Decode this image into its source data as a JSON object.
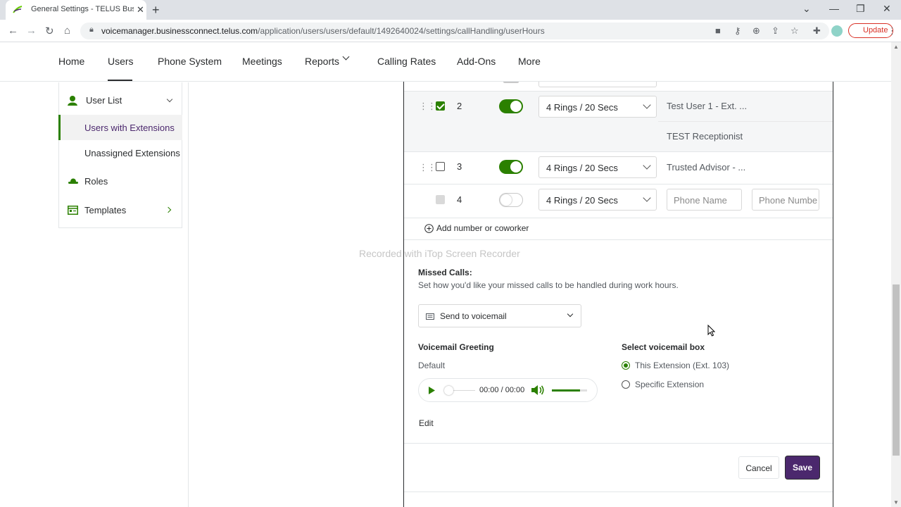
{
  "browser": {
    "tab_title": "General Settings - TELUS Business",
    "url_host": "voicemanager.businessconnect.telus.com",
    "url_path": "/application/users/users/default/1492640024/settings/callHandling/userHours",
    "update_label": "Update"
  },
  "nav": {
    "items": [
      "Home",
      "Users",
      "Phone System",
      "Meetings",
      "Reports",
      "Calling Rates",
      "Add-Ons",
      "More"
    ],
    "active": "Users"
  },
  "sidebar": {
    "user_list": "User List",
    "users_with_extensions": "Users with Extensions",
    "unassigned_extensions": "Unassigned Extensions",
    "roles": "Roles",
    "templates": "Templates"
  },
  "rows": [
    {
      "num": "2",
      "checked": true,
      "enabled": true,
      "rings": "4 Rings / 20 Secs",
      "target": "Test User 1 - Ext. ...",
      "sub": "TEST Receptionist"
    },
    {
      "num": "3",
      "checked": false,
      "enabled": true,
      "rings": "4 Rings / 20 Secs",
      "target": "Trusted Advisor - ..."
    },
    {
      "num": "4",
      "checked": false,
      "enabled": false,
      "rings": "4 Rings / 20 Secs",
      "phone_name_placeholder": "Phone Name",
      "phone_number_placeholder": "Phone Numbe"
    }
  ],
  "add_number": "Add number or coworker",
  "watermark": "Recorded with iTop Screen Recorder",
  "missed_calls": {
    "title": "Missed Calls:",
    "description": "Set how you'd like your missed calls to be handled during work hours.",
    "selected_option": "Send to voicemail"
  },
  "voicemail": {
    "greeting_title": "Voicemail Greeting",
    "greeting_value": "Default",
    "time": "00:00 / 00:00",
    "volume": 0.8,
    "edit_label": "Edit",
    "box_title": "Select voicemail box",
    "option_this": "This Extension (Ext. 103)",
    "option_specific": "Specific Extension"
  },
  "actions": {
    "cancel": "Cancel",
    "save": "Save"
  },
  "colors": {
    "accent_green": "#2b8000",
    "save_purple": "#4b286d"
  }
}
